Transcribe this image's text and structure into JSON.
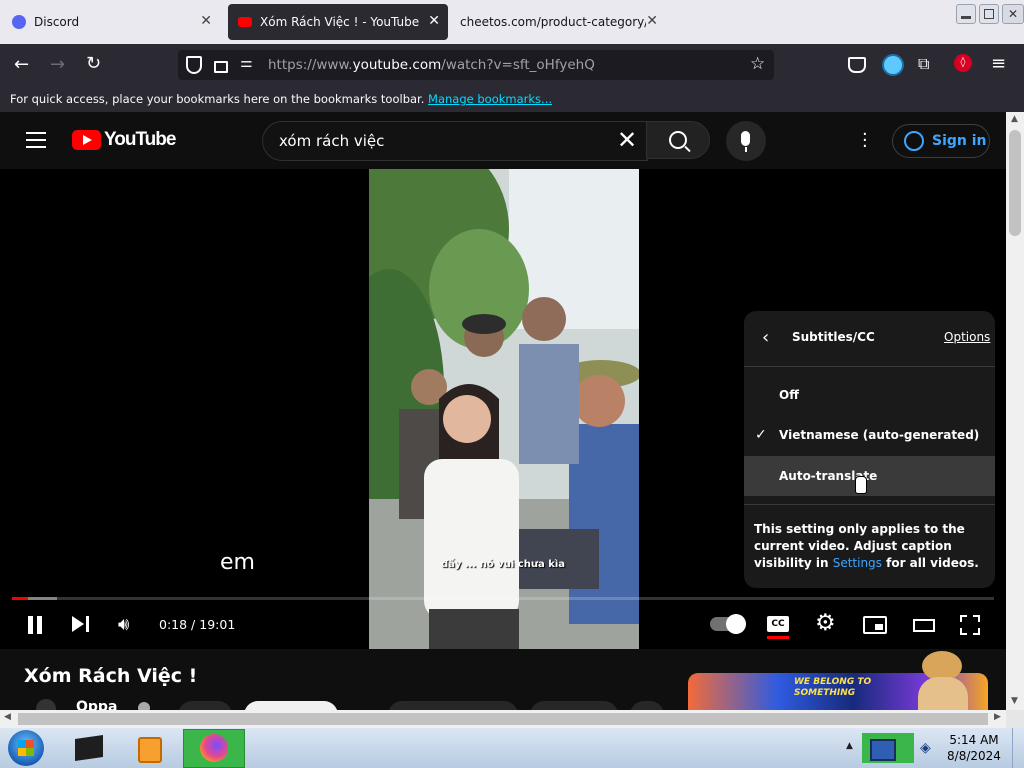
{
  "browser": {
    "tabs": [
      {
        "title": "Discord",
        "icon": "discord-icon"
      },
      {
        "title": "Xóm Rách Việc ! - YouTube",
        "icon": "youtube-icon",
        "active": true
      },
      {
        "title": "cheetos.com/product-category/ma",
        "icon": ""
      }
    ],
    "url_prefix": "https://www.",
    "url_domain": "youtube.com",
    "url_path": "/watch?v=sft_oHfyehQ",
    "bookmarks_text": "For quick access, place your bookmarks here on the bookmarks toolbar.",
    "bookmarks_link": "Manage bookmarks..."
  },
  "youtube": {
    "logo_text": "YouTube",
    "search_value": "xóm rách việc",
    "sign_in": "Sign in"
  },
  "player": {
    "caption": "em",
    "burned_subtitle": "đấy ... nó vui chưa kìa",
    "time_current": "0:18",
    "time_sep": " / ",
    "time_total": "19:01",
    "progress_fraction": 0.016
  },
  "subtitles_menu": {
    "title": "Subtitles/CC",
    "options_label": "Options",
    "items": [
      {
        "label": "Off",
        "checked": false
      },
      {
        "label": "Vietnamese (auto-generated)",
        "checked": true
      },
      {
        "label": "Auto-translate",
        "checked": false
      }
    ],
    "note_text": "This setting only applies to the current video. Adjust caption visibility in",
    "note_link": "Settings",
    "note_suffix": "for all videos."
  },
  "video": {
    "title": "Xóm Rách Việc !",
    "channel_partial": "Oppa",
    "ad_text": "WE BELONG TO SOMETHING"
  },
  "taskbar": {
    "time": "5:14 AM",
    "date": "8/8/2024"
  },
  "colors": {
    "yt_red": "#ff0000",
    "link_blue": "#3ea6ff",
    "browser_dark": "#2b2a33"
  }
}
